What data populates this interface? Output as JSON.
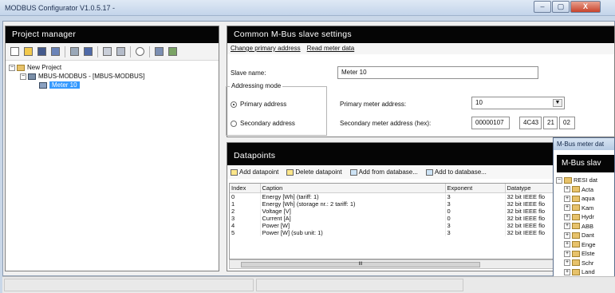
{
  "window": {
    "title": "MODBUS Configurator V1.0.5.17 -",
    "min": "–",
    "max": "▢",
    "close": "X"
  },
  "project_manager": {
    "header": "Project manager",
    "tree": {
      "root": "New Project",
      "modbus": "MBUS-MODBUS - [MBUS-MODBUS]",
      "meter": "Meter 10"
    }
  },
  "slave_settings": {
    "header": "Common M-Bus slave settings",
    "links": {
      "change_address": "Change primary address",
      "read_data": "Read meter data"
    },
    "slave_name_label": "Slave name:",
    "slave_name_value": "Meter 10",
    "addressing_mode_title": "Addressing mode",
    "primary_radio": "Primary address",
    "secondary_radio": "Secondary address",
    "primary_label": "Primary meter address:",
    "primary_value": "10",
    "secondary_label": "Secondary meter address (hex):",
    "secondary_parts": [
      "00000107",
      "4C43",
      "21",
      "02"
    ]
  },
  "datapoints": {
    "header": "Datapoints",
    "toolbar": {
      "add": "Add datapoint",
      "delete": "Delete datapoint",
      "add_from_db": "Add from database...",
      "add_to_db": "Add to database..."
    },
    "columns": [
      "Index",
      "Caption",
      "Exponent",
      "Datatype"
    ],
    "rows": [
      [
        "0",
        "Energy [Wh]  (tariff: 1)",
        "3",
        "32 bit IEEE flo"
      ],
      [
        "1",
        "Energy [Wh]  (storage nr.: 2 tariff: 1)",
        "3",
        "32 bit IEEE flo"
      ],
      [
        "2",
        "Voltage [V]",
        "0",
        "32 bit IEEE flo"
      ],
      [
        "3",
        "Current [A]",
        "0",
        "32 bit IEEE flo"
      ],
      [
        "4",
        "Power [W]",
        "3",
        "32 bit IEEE flo"
      ],
      [
        "5",
        "Power [W]  (sub unit: 1)",
        "3",
        "32 bit IEEE flo"
      ]
    ],
    "scroll_thumb": "III"
  },
  "meter_window": {
    "title": "M-Bus meter dat",
    "header": "M-Bus slav",
    "tree_root": "RESI dat",
    "items": [
      "Acta",
      "aqua",
      "Kam",
      "Hydr",
      "ABB",
      "Dant",
      "Enge",
      "Elste",
      "Schr",
      "Land"
    ]
  }
}
